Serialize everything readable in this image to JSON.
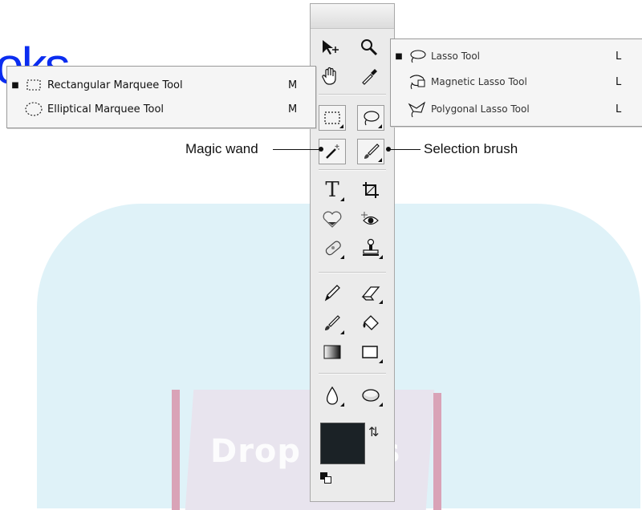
{
  "watermark": {
    "corner_text": "oks",
    "logo_text": "Drop  ooks"
  },
  "toolbar": {
    "tools": [
      {
        "name": "move-tool",
        "icon": "move-arrow-icon",
        "glyph": "➤"
      },
      {
        "name": "zoom-tool",
        "icon": "magnifier-icon",
        "glyph": "🔍"
      },
      {
        "name": "hand-tool",
        "icon": "hand-icon",
        "glyph": "✋"
      },
      {
        "name": "eyedropper-tool",
        "icon": "eyedropper-icon",
        "glyph": "✎"
      },
      {
        "name": "rectangular-marquee-tool",
        "icon": "dashed-rect-icon",
        "glyph": "⬚"
      },
      {
        "name": "lasso-tool",
        "icon": "lasso-icon",
        "glyph": "◌"
      },
      {
        "name": "magic-wand-tool",
        "icon": "magic-wand-icon",
        "glyph": "✧"
      },
      {
        "name": "selection-brush-tool",
        "icon": "brush-icon",
        "glyph": "✐"
      },
      {
        "name": "type-tool",
        "icon": "type-icon",
        "glyph": "T"
      },
      {
        "name": "crop-tool",
        "icon": "crop-icon",
        "glyph": "⌗"
      },
      {
        "name": "cookie-cutter-tool",
        "icon": "heart-icon",
        "glyph": "♥"
      },
      {
        "name": "red-eye-tool",
        "icon": "eye-icon",
        "glyph": "◉"
      },
      {
        "name": "healing-brush-tool",
        "icon": "bandage-icon",
        "glyph": "✚"
      },
      {
        "name": "clone-stamp-tool",
        "icon": "stamp-icon",
        "glyph": "♙"
      },
      {
        "name": "pencil-tool",
        "icon": "pencil-icon",
        "glyph": "✏"
      },
      {
        "name": "eraser-tool",
        "icon": "eraser-icon",
        "glyph": "⌫"
      },
      {
        "name": "brush-tool",
        "icon": "paintbrush-icon",
        "glyph": "✒"
      },
      {
        "name": "paint-bucket-tool",
        "icon": "bucket-icon",
        "glyph": "⛾"
      },
      {
        "name": "gradient-tool",
        "icon": "gradient-icon",
        "glyph": "▤"
      },
      {
        "name": "shape-tool",
        "icon": "rectangle-shape-icon",
        "glyph": "▭"
      },
      {
        "name": "blur-tool",
        "icon": "drop-icon",
        "glyph": "💧"
      },
      {
        "name": "sponge-tool",
        "icon": "sponge-icon",
        "glyph": "⬮"
      }
    ],
    "swap_glyph": "⇅",
    "foreground_color": "#1b2226"
  },
  "marquee_menu": {
    "items": [
      {
        "label": "Rectangular Marquee Tool",
        "shortcut": "M",
        "bullet": "■",
        "icon": "dashed-rect-icon"
      },
      {
        "label": "Elliptical Marquee Tool",
        "shortcut": "M",
        "bullet": "",
        "icon": "dashed-ellipse-icon"
      }
    ]
  },
  "lasso_menu": {
    "items": [
      {
        "label": "Lasso Tool",
        "shortcut": "L",
        "bullet": "■",
        "icon": "lasso-icon"
      },
      {
        "label": "Magnetic Lasso Tool",
        "shortcut": "L",
        "bullet": "",
        "icon": "magnetic-lasso-icon"
      },
      {
        "label": "Polygonal Lasso Tool",
        "shortcut": "L",
        "bullet": "",
        "icon": "polygonal-lasso-icon"
      }
    ]
  },
  "callouts": {
    "magic_wand": "Magic wand",
    "selection_brush": "Selection brush"
  }
}
